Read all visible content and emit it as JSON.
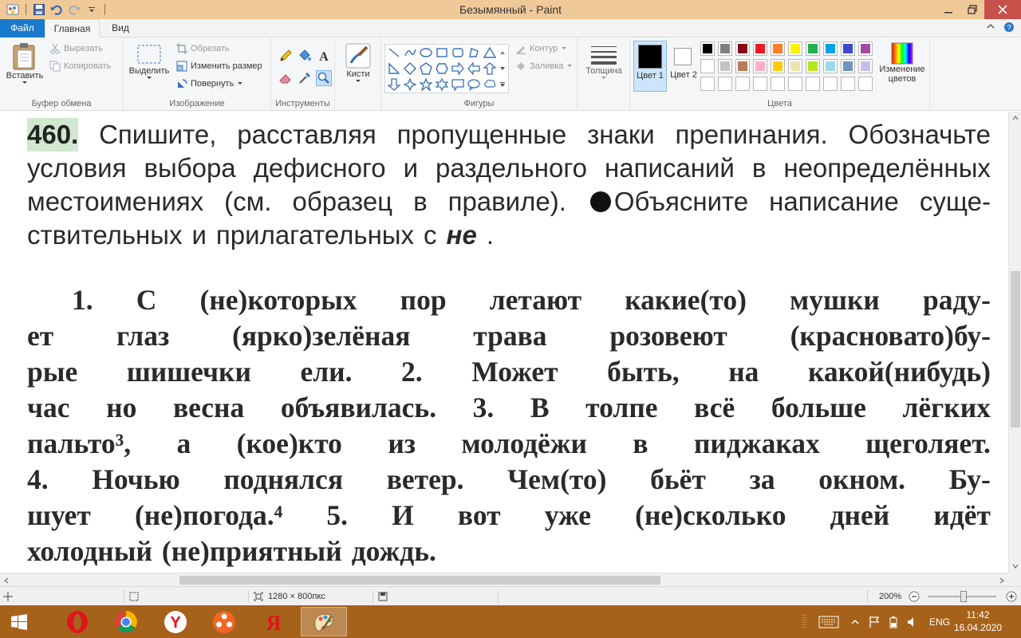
{
  "window": {
    "title": "Безымянный - Paint"
  },
  "tabs": {
    "file": "Файл",
    "home": "Главная",
    "view": "Вид"
  },
  "clipboard": {
    "paste": "Вставить",
    "cut": "Вырезать",
    "copy": "Копировать",
    "label": "Буфер обмена"
  },
  "image": {
    "select": "Выделить",
    "crop": "Обрезать",
    "resize": "Изменить размер",
    "rotate": "Повернуть",
    "label": "Изображение"
  },
  "tools": {
    "label": "Инструменты"
  },
  "brushes": {
    "label": "Кисти"
  },
  "shapes": {
    "outline": "Контур",
    "fill": "Заливка",
    "label": "Фигуры"
  },
  "size": {
    "label": "Толщина"
  },
  "colors": {
    "color1": "Цвет 1",
    "color2": "Цвет 2",
    "edit": "Изменение цветов",
    "label": "Цвета",
    "palette_row1": [
      "#000000",
      "#7f7f7f",
      "#880015",
      "#ed1c24",
      "#ff7f27",
      "#fff200",
      "#22b14c",
      "#00a2e8",
      "#3f48cc",
      "#a349a4"
    ],
    "palette_row2": [
      "#ffffff",
      "#c3c3c3",
      "#b97a57",
      "#ffaec9",
      "#ffc90e",
      "#efe4b0",
      "#b5e61d",
      "#99d9ea",
      "#7092be",
      "#c8bfe7"
    ]
  },
  "document": {
    "exercise_number": "460.",
    "intro_line1": [
      "Спишите,",
      "расставляя",
      "пропущенные",
      "знаки",
      "препинания.",
      "Обозначьте"
    ],
    "intro_line2": [
      "условия",
      "выбора",
      "дефисного",
      "и",
      "раздельного",
      "написаний",
      "в",
      "неопределённых"
    ],
    "intro_line3a": [
      "местоимениях",
      "(см.",
      "образец",
      "в",
      "правиле)."
    ],
    "intro_line3b": [
      "Объясните",
      "написание",
      "суще-"
    ],
    "intro_line4": [
      "ствительных",
      "и",
      "прилагательных",
      "с"
    ],
    "intro_ne": "не",
    "intro_end": ".",
    "body_lines": [
      [
        "1.",
        "С",
        "(не)которых",
        "пор",
        "летают",
        "какие(то)",
        "мушки",
        "раду-"
      ],
      [
        "ет",
        "глаз",
        "(ярко)зелёная",
        "трава",
        "розовеют",
        "(красновато)бу-"
      ],
      [
        "рые",
        "шишечки",
        "ели.",
        "2.",
        "Может",
        "быть,",
        "на",
        "какой(нибудь)"
      ],
      [
        "час",
        "но",
        "весна",
        "объявилась.",
        "3.",
        "В",
        "толпе",
        "всё",
        "больше",
        "лёгких"
      ],
      [
        "пальто³,",
        "а",
        "(кое)кто",
        "из",
        "молодёжи",
        "в",
        "пиджаках",
        "щеголяет."
      ],
      [
        "4.",
        "Ночью",
        "поднялся",
        "ветер.",
        "Чем(то)",
        "бьёт",
        "за",
        "окном.",
        "Бу-"
      ],
      [
        "шует",
        "(не)погода.⁴",
        "5.",
        "И",
        "вот",
        "уже",
        "(не)сколько",
        "дней",
        "идёт"
      ],
      [
        "холодный",
        "(не)приятный",
        "дождь."
      ]
    ]
  },
  "status": {
    "dimensions": "1280 × 800пкс",
    "zoom": "200%",
    "zoom_level_fraction": 0.52
  },
  "taskbar": {
    "lang": "ENG",
    "time": "11:42",
    "date": "16.04.2020",
    "apps": [
      "opera-icon",
      "chrome-icon",
      "yandex-browser-icon",
      "media-player-icon",
      "yandex-icon",
      "paint-icon"
    ]
  }
}
